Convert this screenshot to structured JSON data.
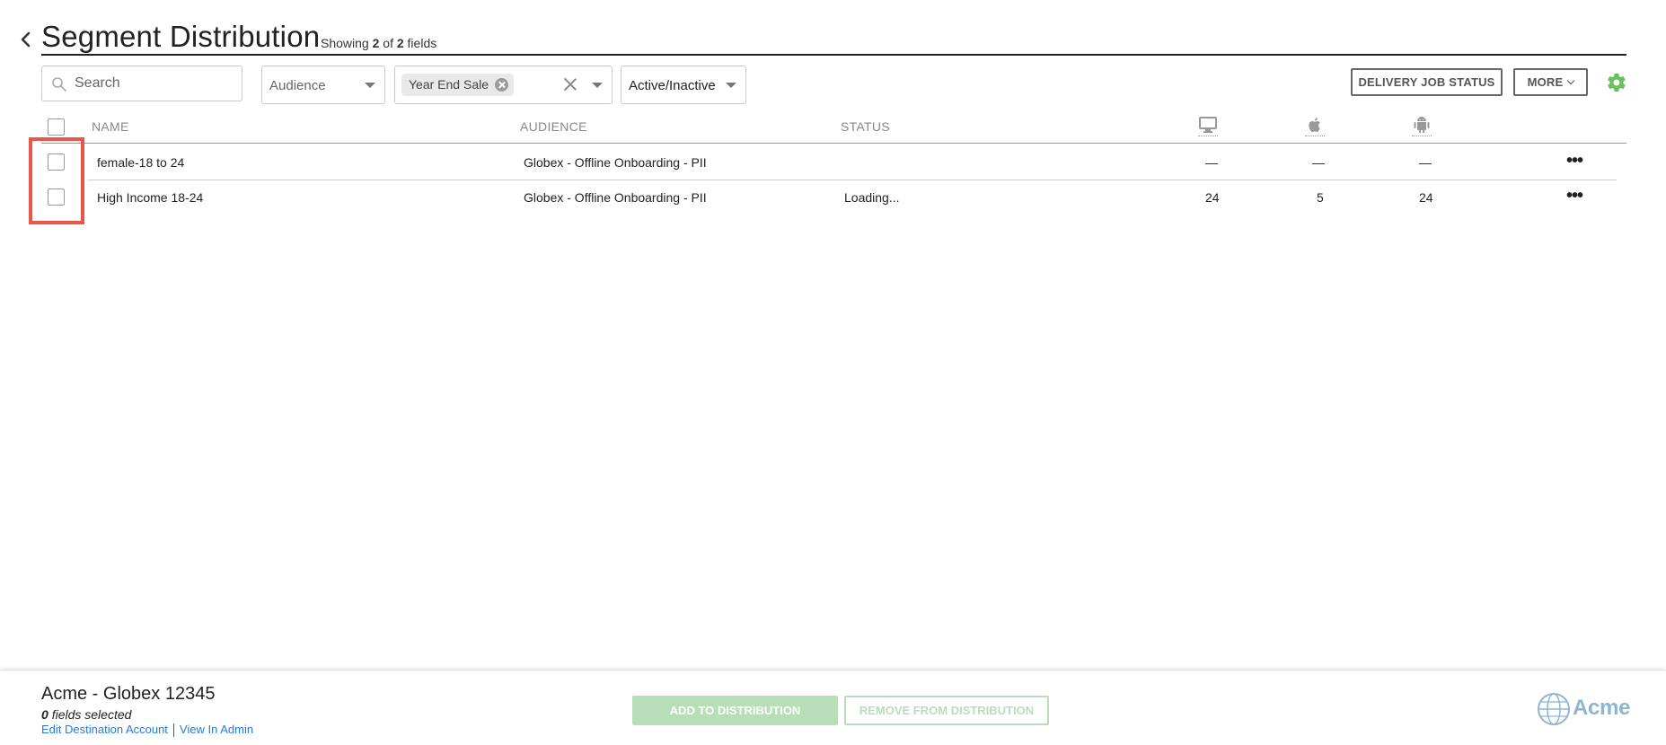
{
  "header": {
    "title": "Segment Distribution",
    "showing_prefix": "Showing",
    "showing_count": "2",
    "showing_of": "of",
    "showing_total": "2",
    "showing_suffix": "fields"
  },
  "toolbar": {
    "search_placeholder": "Search",
    "audience_placeholder": "Audience",
    "campaign_chip": "Year End Sale",
    "status_value": "Active/Inactive",
    "delivery_button": "DELIVERY JOB STATUS",
    "more_button": "MORE"
  },
  "table": {
    "columns": {
      "name": "NAME",
      "audience": "AUDIENCE",
      "status": "STATUS"
    },
    "column_icons": [
      "desktop-icon",
      "apple-icon",
      "android-icon"
    ],
    "rows": [
      {
        "name": "female-18 to 24",
        "audience": "Globex - Offline Onboarding - PII",
        "status": "",
        "desktop": "—",
        "ios": "—",
        "android": "—"
      },
      {
        "name": "High Income 18-24",
        "audience": "Globex - Offline Onboarding - PII",
        "status": "Loading...",
        "desktop": "24",
        "ios": "5",
        "android": "24"
      }
    ]
  },
  "footer": {
    "account_name": "Acme - Globex 12345",
    "selected_count": "0",
    "selected_label": "fields selected",
    "edit_link": "Edit Destination Account",
    "admin_link": "View In Admin",
    "add_button": "ADD TO DISTRIBUTION",
    "remove_button": "REMOVE FROM DISTRIBUTION",
    "brand": "Acme"
  },
  "colors": {
    "accent_green": "#6abf5e",
    "disabled_green": "#b8deb8",
    "link_blue": "#2a7bd3",
    "highlight_red": "#e8584a"
  }
}
